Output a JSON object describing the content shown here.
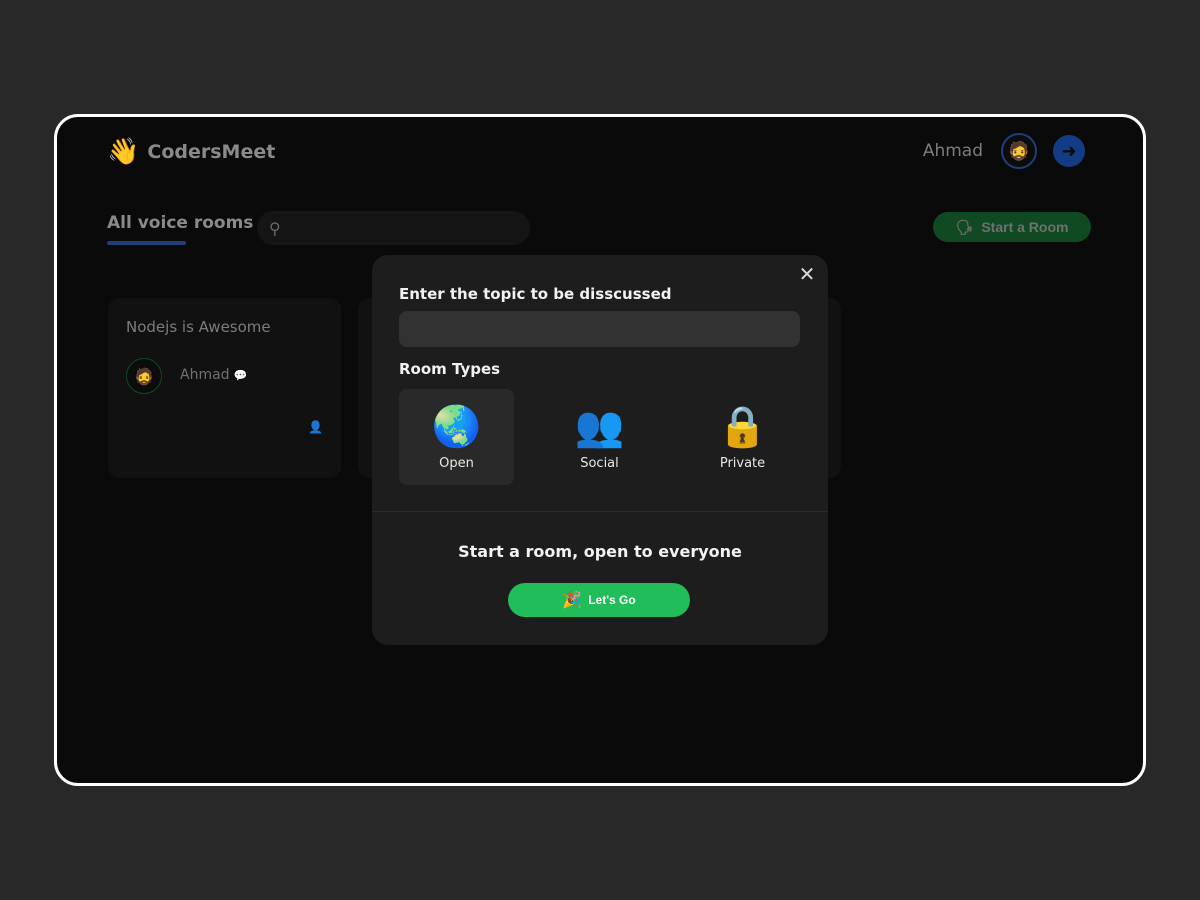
{
  "app": {
    "name": "CodersMeet",
    "logo_icon": "👋",
    "user_name": "Ahmad",
    "avatar_icon": "🧔",
    "logout_icon": "➜"
  },
  "toolbar": {
    "tab_title": "All voice rooms",
    "search_icon": "🔍",
    "search_placeholder": "",
    "search_value": "",
    "start_room_icon": "🗣",
    "start_room_label": "Start a Room"
  },
  "rooms": [
    {
      "title": "Nodejs is Awesome",
      "speaker": "Ahmad",
      "speaker_avatar": "🧔",
      "chat_icon": "💬",
      "count_icon": "👤"
    }
  ],
  "modal": {
    "close_icon": "✕",
    "topic_label": "Enter the topic to be disscussed",
    "topic_value": "",
    "topic_placeholder": "",
    "types_label": "Room Types",
    "types": [
      {
        "label": "Open",
        "icon": "🌏",
        "selected": true
      },
      {
        "label": "Social",
        "icon": "👥",
        "selected": false
      },
      {
        "label": "Private",
        "icon": "🔒",
        "selected": false
      }
    ],
    "subtitle": "Start a room, open to everyone",
    "go_icon": "🎉",
    "go_label": "Let's Go"
  },
  "colors": {
    "accent_blue": "#0f5bd6",
    "accent_green": "#20bd5a",
    "modal_bg": "#1d1d1d"
  }
}
